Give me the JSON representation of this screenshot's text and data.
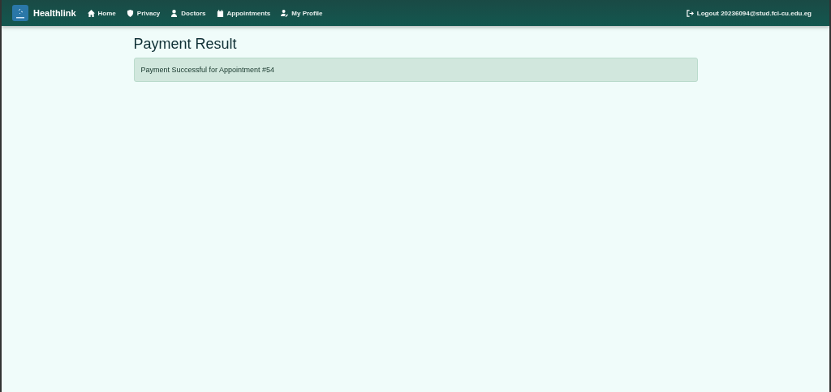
{
  "brand": {
    "name": "Healthlink"
  },
  "nav": [
    {
      "label": "Home"
    },
    {
      "label": "Privacy"
    },
    {
      "label": "Doctors"
    },
    {
      "label": "Appointments"
    },
    {
      "label": "My Profile"
    }
  ],
  "logout": {
    "label": "Logout 20236094@stud.fci-cu.edu.eg"
  },
  "page": {
    "title": "Payment Result",
    "alert": "Payment Successful for Appointment #54"
  }
}
